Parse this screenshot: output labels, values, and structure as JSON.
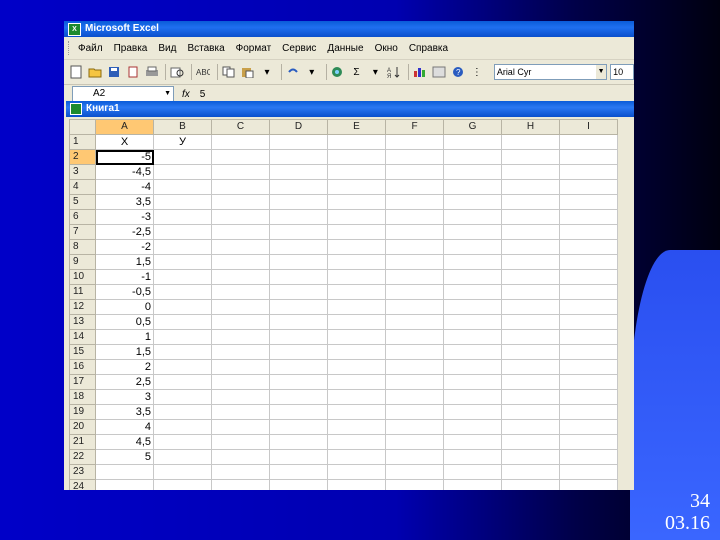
{
  "slide": {
    "number": "34",
    "date": "03.16"
  },
  "app": {
    "title": "Microsoft Excel",
    "workbook_title": "Книга1"
  },
  "menu": [
    "Файл",
    "Правка",
    "Вид",
    "Вставка",
    "Формат",
    "Сервис",
    "Данные",
    "Окно",
    "Справка"
  ],
  "toolbar": {
    "font_name": "Arial Cyr",
    "font_size": "10",
    "sum_symbol": "Σ"
  },
  "formula_bar": {
    "cell_ref": "A2",
    "fx": "fx",
    "value": "5"
  },
  "sheet": {
    "columns": [
      "A",
      "B",
      "C",
      "D",
      "E",
      "F",
      "G",
      "H",
      "I"
    ],
    "rows": [
      {
        "n": "1",
        "a": "X",
        "b": "У"
      },
      {
        "n": "2",
        "a": "-5",
        "b": ""
      },
      {
        "n": "3",
        "a": "-4,5",
        "b": ""
      },
      {
        "n": "4",
        "a": "-4",
        "b": ""
      },
      {
        "n": "5",
        "a": "3,5",
        "b": ""
      },
      {
        "n": "6",
        "a": "-3",
        "b": ""
      },
      {
        "n": "7",
        "a": "-2,5",
        "b": ""
      },
      {
        "n": "8",
        "a": "-2",
        "b": ""
      },
      {
        "n": "9",
        "a": "1,5",
        "b": ""
      },
      {
        "n": "10",
        "a": "-1",
        "b": ""
      },
      {
        "n": "11",
        "a": "-0,5",
        "b": ""
      },
      {
        "n": "12",
        "a": "0",
        "b": ""
      },
      {
        "n": "13",
        "a": "0,5",
        "b": ""
      },
      {
        "n": "14",
        "a": "1",
        "b": ""
      },
      {
        "n": "15",
        "a": "1,5",
        "b": ""
      },
      {
        "n": "16",
        "a": "2",
        "b": ""
      },
      {
        "n": "17",
        "a": "2,5",
        "b": ""
      },
      {
        "n": "18",
        "a": "3",
        "b": ""
      },
      {
        "n": "19",
        "a": "3,5",
        "b": ""
      },
      {
        "n": "20",
        "a": "4",
        "b": ""
      },
      {
        "n": "21",
        "a": "4,5",
        "b": ""
      },
      {
        "n": "22",
        "a": "5",
        "b": ""
      },
      {
        "n": "23",
        "a": "",
        "b": ""
      },
      {
        "n": "24",
        "a": "",
        "b": ""
      }
    ]
  }
}
